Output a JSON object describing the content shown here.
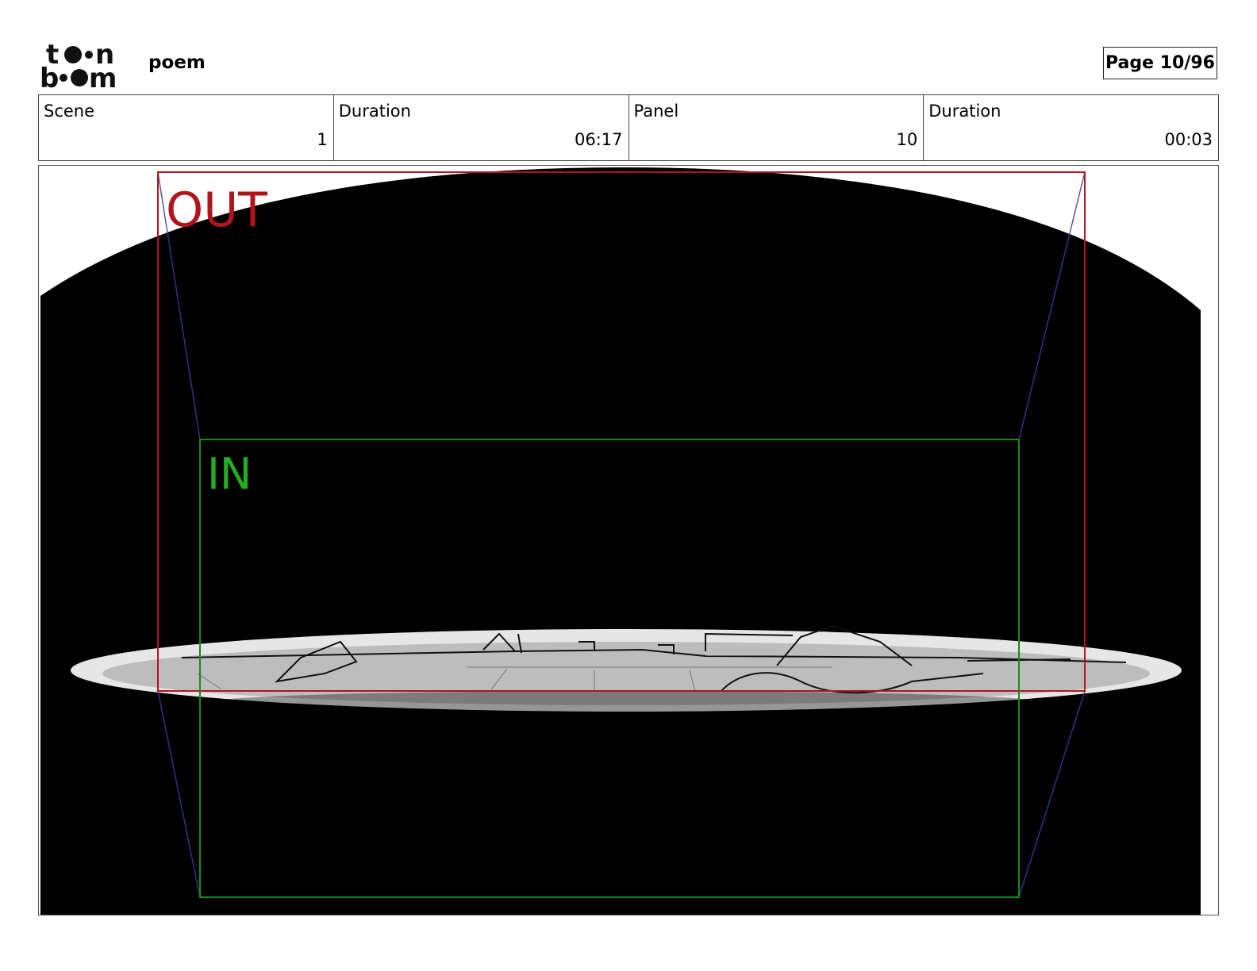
{
  "header": {
    "logo": {
      "line1": "toon",
      "line2": "boom",
      "icon": "toon-boom-logo"
    },
    "project_title": "poem",
    "page_indicator": "Page 10/96"
  },
  "info": {
    "scene_label": "Scene",
    "scene_value": "1",
    "scene_duration_label": "Duration",
    "scene_duration_value": "06:17",
    "panel_label": "Panel",
    "panel_value": "10",
    "panel_duration_label": "Duration",
    "panel_duration_value": "00:03"
  },
  "panel": {
    "out_label": "OUT",
    "in_label": "IN",
    "colors": {
      "out_frame": "#b0141c",
      "in_frame": "#1a8a1a",
      "in_text": "#22b022",
      "motion_lines": "#3a3aa0",
      "background": "#000000",
      "ground": "#bdbdbd"
    }
  }
}
